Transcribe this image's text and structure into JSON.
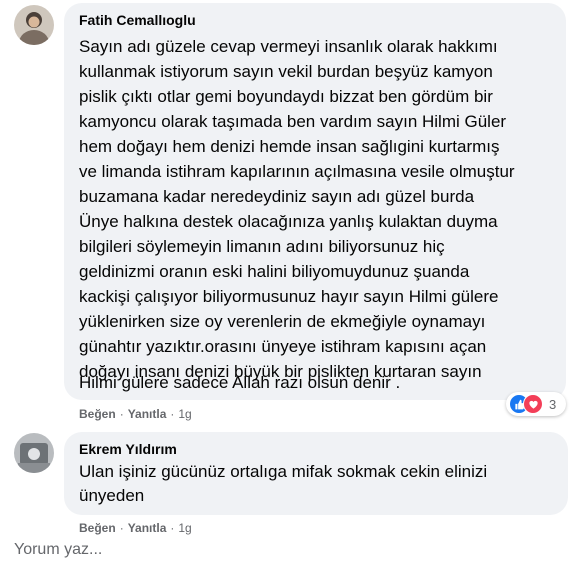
{
  "comments": [
    {
      "author": "Fatih Cemallıoglu",
      "lines": [
        "Sayın adı güzele cevap vermeyi insanlık olarak hakkımı",
        "kullanmak istiyorum sayın vekil burdan beşyüz kamyon",
        "pislik çıktı otlar gemi boyundaydı bizzat ben gördüm bir",
        "kamyoncu olarak taşımada ben vardım sayın Hilmi Güler",
        "hem doğayı hem denizi hemde insan sağlıgini kurtarmış",
        "ve limanda istihram kapılarının açılmasına vesile olmuştur",
        "buzamana kadar neredeydiniz sayın adı güzel burda",
        "Ünye halkına destek olacağınıza yanlış kulaktan duyma",
        "bilgileri söylemeyin limanın adını biliyorsunuz hiç",
        "geldinizmi oranın eski halini biliyomuydunuz şuanda",
        "kackişi çalışıyor biliyormusunuz hayır sayın Hilmi gülere",
        "yüklenirken size oy verenlerin de ekmeğiyle oynamayı",
        "günahtır yazıktır.orasını ünyeye istihram kapısını açan",
        "doğayı insanı denizi büyük bir pislikten kurtaran sayın",
        "Hilmi gülere sadece Allah razı olsun denir ."
      ],
      "actions": {
        "like": "Beğen",
        "reply": "Yanıtla",
        "time": "1g"
      },
      "reaction_count": "3"
    },
    {
      "author": "Ekrem Yıldırım",
      "lines": [
        "Ulan işiniz gücünüz ortalıga mifak sokmak cekin elinizi",
        "ünyeden"
      ],
      "actions": {
        "like": "Beğen",
        "reply": "Yanıtla",
        "time": "1g"
      }
    }
  ],
  "composer": {
    "placeholder": "Yorum yaz..."
  },
  "colors": {
    "bubble": "#f0f2f5",
    "muted": "#65676b",
    "like_blue": "#1877f2",
    "love_red": "#f33e58"
  },
  "icons": {
    "like": "thumbs-up-icon",
    "love": "heart-icon"
  }
}
